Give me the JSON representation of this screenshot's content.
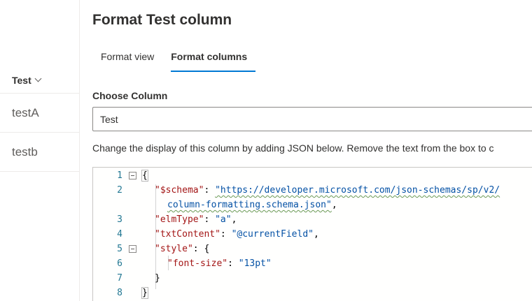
{
  "list": {
    "column_header": "Test",
    "rows": [
      "testA",
      "testb"
    ]
  },
  "pane": {
    "title": "Format Test column",
    "tabs": [
      {
        "label": "Format view",
        "active": false
      },
      {
        "label": "Format columns",
        "active": true
      }
    ],
    "choose_label": "Choose Column",
    "column_value": "Test",
    "help_text": "Change the display of this column by adding JSON below. Remove the text from the box to c"
  },
  "editor": {
    "line_numbers": [
      "1",
      "2",
      "3",
      "4",
      "5",
      "6",
      "7",
      "8"
    ],
    "l1": "{",
    "l2_key": "\"$schema\"",
    "l2_sep": ": ",
    "l2_val": "\"https://developer.microsoft.com/json-schemas/sp/v2/",
    "l2b_val": "column-formatting.schema.json\"",
    "l2b_end": ",",
    "l3_key": "\"elmType\"",
    "l3_sep": ": ",
    "l3_val": "\"a\"",
    "l3_end": ",",
    "l4_key": "\"txtContent\"",
    "l4_sep": ": ",
    "l4_val": "\"@currentField\"",
    "l4_end": ",",
    "l5_key": "\"style\"",
    "l5_sep": ": {",
    "l6_key": "\"font-size\"",
    "l6_sep": ": ",
    "l6_val": "\"13pt\"",
    "l7": "}",
    "l8": "}"
  },
  "colors": {
    "accent": "#0078d4",
    "json_key": "#a31515",
    "json_string": "#0451a5",
    "line_number": "#237893"
  }
}
